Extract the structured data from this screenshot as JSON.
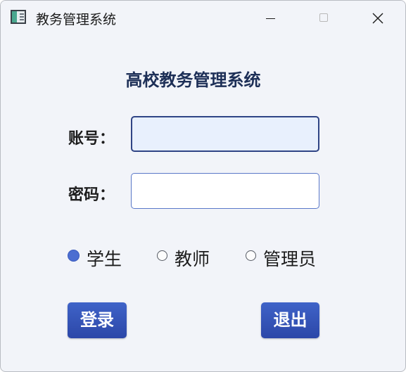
{
  "window": {
    "title": "教务管理系统",
    "app_icon": "app-window-icon",
    "controls": {
      "minimize_icon": "minimize-icon",
      "maximize_icon": "maximize-icon",
      "close_icon": "close-icon"
    }
  },
  "form": {
    "heading": "高校教务管理系统",
    "account_label": "账号：",
    "account_value": "",
    "password_label": "密码：",
    "password_value": "",
    "roles": [
      {
        "label": "学生",
        "checked": true
      },
      {
        "label": "教师",
        "checked": false
      },
      {
        "label": "管理员",
        "checked": false
      }
    ],
    "login_label": "登录",
    "exit_label": "退出"
  },
  "colors": {
    "accent": "#3f63c8",
    "heading": "#1d2f57",
    "focus_border": "#2f4485",
    "focus_fill": "#e8f0fd"
  }
}
